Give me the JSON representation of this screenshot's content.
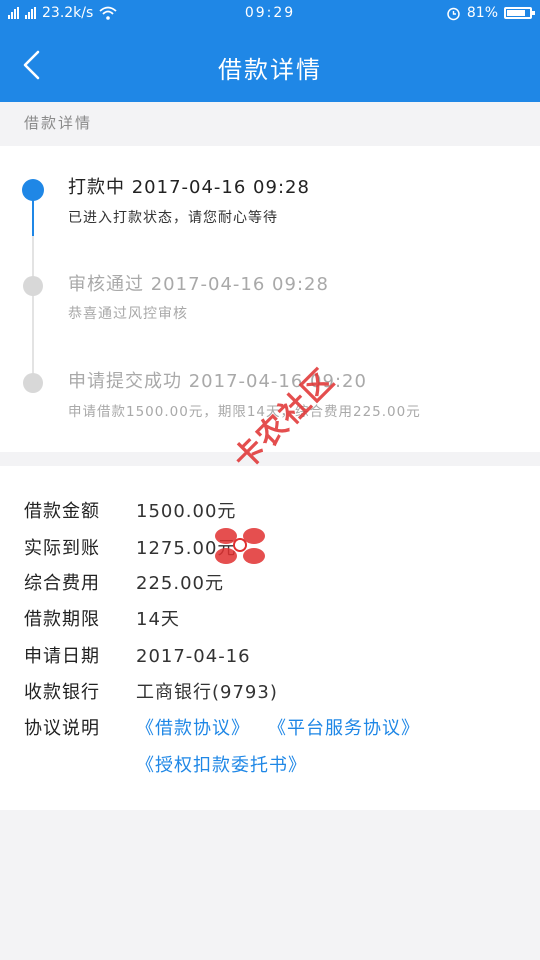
{
  "status_bar": {
    "network": "23.2k/s",
    "time": "09:29",
    "battery": "81%",
    "battery_level": 0.81,
    "network_type": "4G"
  },
  "nav": {
    "title": "借款详情",
    "back_icon": "chevron-left-icon"
  },
  "section": {
    "label": "借款详情"
  },
  "timeline": [
    {
      "title": "打款中 2017-04-16 09:28",
      "desc": "已进入打款状态，请您耐心等待",
      "state": "active"
    },
    {
      "title": "审核通过 2017-04-16 09:28",
      "desc": "恭喜通过风控审核",
      "state": "done"
    },
    {
      "title": "申请提交成功 2017-04-16 09:20",
      "desc": "申请借款1500.00元，期限14天，综合费用225.00元",
      "state": "done"
    }
  ],
  "details": {
    "amount": {
      "label": "借款金额",
      "value": "1500.00元"
    },
    "received": {
      "label": "实际到账",
      "value": "1275.00元"
    },
    "fee": {
      "label": "综合费用",
      "value": "225.00元"
    },
    "term": {
      "label": "借款期限",
      "value": "14天"
    },
    "apply_date": {
      "label": "申请日期",
      "value": "2017-04-16"
    },
    "bank": {
      "label": "收款银行",
      "value": "工商银行(9793)"
    },
    "agreements": {
      "label": "协议说明",
      "links": [
        "《借款协议》",
        "《平台服务协议》",
        "《授权扣款委托书》"
      ]
    }
  },
  "watermark": {
    "text": "卡农社区"
  },
  "colors": {
    "accent": "#1f87e6",
    "inactive": "#d8d8d8",
    "watermark": "#e03030"
  }
}
